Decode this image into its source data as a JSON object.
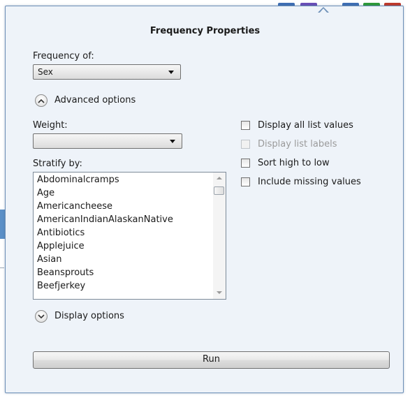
{
  "background": {
    "tab_colors": [
      "#3f6fb5",
      "#6b4fb8",
      "#3f6fb5",
      "#2e9a3a",
      "#c0392b"
    ]
  },
  "dialog": {
    "title": "Frequency Properties",
    "frequency_of": {
      "label": "Frequency of:",
      "selected": "Sex"
    },
    "advanced_options": {
      "label": "Advanced options",
      "expanded": true
    },
    "weight": {
      "label": "Weight:",
      "selected": ""
    },
    "stratify_by": {
      "label": "Stratify by:",
      "items": [
        "Abdominalcramps",
        "Age",
        "Americancheese",
        "AmericanIndianAlaskanNative",
        "Antibiotics",
        "Applejuice",
        "Asian",
        "Beansprouts",
        "Beefjerkey"
      ]
    },
    "checkboxes": [
      {
        "label": "Display all list values",
        "checked": false,
        "enabled": true
      },
      {
        "label": "Display list labels",
        "checked": false,
        "enabled": false
      },
      {
        "label": "Sort high to low",
        "checked": false,
        "enabled": true
      },
      {
        "label": "Include missing values",
        "checked": false,
        "enabled": true
      }
    ],
    "display_options": {
      "label": "Display options",
      "expanded": false
    },
    "run_label": "Run"
  }
}
